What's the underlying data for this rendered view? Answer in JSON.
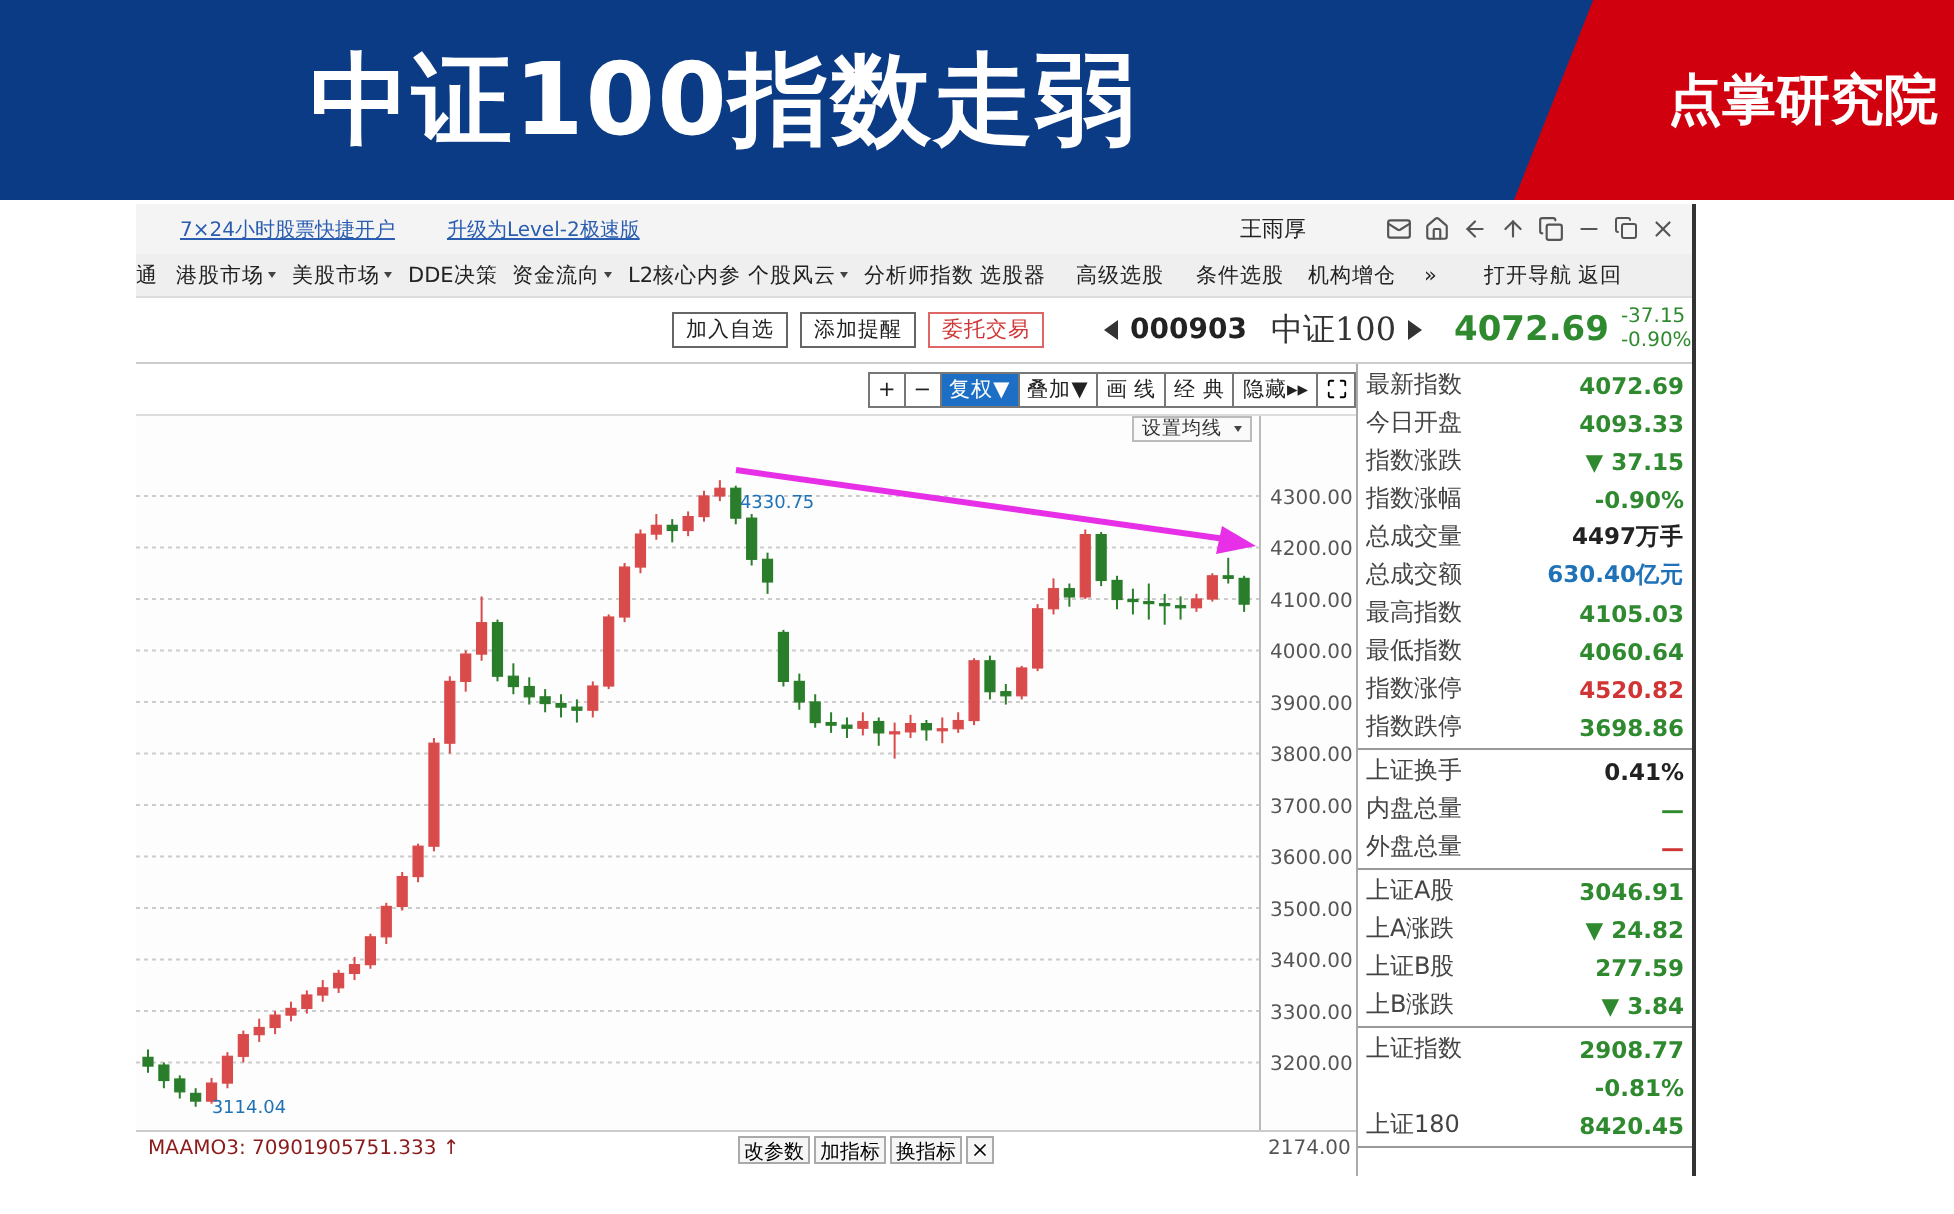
{
  "slide": {
    "title": "中证100指数走弱",
    "brand": "点掌研究院"
  },
  "top_bar": {
    "links": [
      "7×24小时股票快捷开户",
      "升级为Level-2极速版"
    ],
    "user": "王雨厚"
  },
  "menu": [
    {
      "label": "通",
      "dropdown": false
    },
    {
      "label": "港股市场",
      "dropdown": true
    },
    {
      "label": "美股市场",
      "dropdown": true
    },
    {
      "label": "DDE决策",
      "dropdown": false
    },
    {
      "label": "资金流向",
      "dropdown": true
    },
    {
      "label": "L2核心内参",
      "dropdown": false
    },
    {
      "label": "个股风云",
      "dropdown": true
    },
    {
      "label": "分析师指数",
      "dropdown": false
    },
    {
      "label": "选股器",
      "dropdown": false
    },
    {
      "label": "高级选股",
      "dropdown": false
    },
    {
      "label": "条件选股",
      "dropdown": false
    },
    {
      "label": "机构增仓",
      "dropdown": false
    },
    {
      "label": "»",
      "dropdown": false
    },
    {
      "label": "打开导航",
      "dropdown": false
    },
    {
      "label": "返回",
      "dropdown": false
    }
  ],
  "quote": {
    "buttons": [
      {
        "label": "加入自选",
        "kind": "plain"
      },
      {
        "label": "添加提醒",
        "kind": "plain"
      },
      {
        "label": "委托交易",
        "kind": "trade"
      }
    ],
    "code": "000903",
    "name": "中证100",
    "price": "4072.69",
    "change": "-37.15",
    "change_pct": "-0.90%"
  },
  "chart": {
    "toolbar": [
      {
        "label": "+",
        "selected": false
      },
      {
        "label": "−",
        "selected": false
      },
      {
        "label": "复权▼",
        "selected": true
      },
      {
        "label": "叠加▼",
        "selected": false
      },
      {
        "label": "画 线",
        "selected": false
      },
      {
        "label": "经 典",
        "selected": false
      },
      {
        "label": "隐藏▸▸",
        "selected": false
      }
    ],
    "ma_setting": "设置均线",
    "chart_data": {
      "type": "candlestick",
      "grid": true,
      "ylim": [
        3068.9,
        4455.3
      ],
      "yticks": [
        {
          "value": 4300,
          "label": "4300.00"
        },
        {
          "value": 4200,
          "label": "4200.00"
        },
        {
          "value": 4100,
          "label": "4100.00"
        },
        {
          "value": 4000,
          "label": "4000.00"
        },
        {
          "value": 3900,
          "label": "3900.00"
        },
        {
          "value": 3800,
          "label": "3800.00"
        },
        {
          "value": 3700,
          "label": "3700.00"
        },
        {
          "value": 3600,
          "label": "3600.00"
        },
        {
          "value": 3500,
          "label": "3500.00"
        },
        {
          "value": 3400,
          "label": "3400.00"
        },
        {
          "value": 3300,
          "label": "3300.00"
        },
        {
          "value": 3200,
          "label": "3200.00"
        }
      ],
      "categories": [
        null,
        null,
        null,
        null,
        null,
        null,
        null,
        null,
        null,
        null,
        null,
        null,
        null,
        null,
        null,
        null,
        null,
        null,
        null,
        null,
        null,
        null,
        null,
        null,
        null,
        null,
        null,
        null,
        null,
        null,
        null,
        null,
        null,
        null,
        null,
        null,
        null,
        null,
        null,
        null,
        null,
        null,
        null,
        null,
        null,
        null,
        null,
        null,
        null,
        null,
        null,
        null,
        null,
        null,
        null,
        null,
        null,
        null,
        null,
        null,
        null,
        null,
        null,
        null,
        null,
        null,
        null,
        null,
        null,
        null
      ],
      "ohlc": [
        [
          3210,
          3225,
          3180,
          3193
        ],
        [
          3195,
          3200,
          3150,
          3165
        ],
        [
          3168,
          3175,
          3130,
          3143
        ],
        [
          3140,
          3150,
          3114.04,
          3125
        ],
        [
          3125,
          3170,
          3120,
          3160
        ],
        [
          3160,
          3220,
          3150,
          3212
        ],
        [
          3212,
          3262,
          3200,
          3254
        ],
        [
          3254,
          3285,
          3240,
          3268
        ],
        [
          3268,
          3300,
          3255,
          3292
        ],
        [
          3292,
          3318,
          3280,
          3305
        ],
        [
          3305,
          3340,
          3295,
          3331
        ],
        [
          3331,
          3360,
          3318,
          3345
        ],
        [
          3345,
          3380,
          3335,
          3373
        ],
        [
          3373,
          3405,
          3360,
          3390
        ],
        [
          3390,
          3450,
          3382,
          3444
        ],
        [
          3444,
          3510,
          3430,
          3503
        ],
        [
          3503,
          3570,
          3495,
          3561
        ],
        [
          3561,
          3625,
          3550,
          3620
        ],
        [
          3620,
          3830,
          3610,
          3820
        ],
        [
          3820,
          3950,
          3800,
          3940
        ],
        [
          3940,
          4000,
          3920,
          3993
        ],
        [
          3993,
          4105,
          3980,
          4054
        ],
        [
          4054,
          4060,
          3940,
          3950
        ],
        [
          3950,
          3975,
          3915,
          3930
        ],
        [
          3930,
          3948,
          3895,
          3910
        ],
        [
          3910,
          3925,
          3880,
          3897
        ],
        [
          3897,
          3915,
          3870,
          3890
        ],
        [
          3890,
          3905,
          3860,
          3884
        ],
        [
          3884,
          3940,
          3870,
          3931
        ],
        [
          3931,
          4070,
          3925,
          4065
        ],
        [
          4065,
          4170,
          4055,
          4162
        ],
        [
          4162,
          4235,
          4150,
          4226
        ],
        [
          4226,
          4265,
          4215,
          4243
        ],
        [
          4243,
          4255,
          4210,
          4233
        ],
        [
          4233,
          4270,
          4222,
          4260
        ],
        [
          4260,
          4310,
          4250,
          4300
        ],
        [
          4300,
          4330.75,
          4290,
          4315
        ],
        [
          4315,
          4320,
          4245,
          4257
        ],
        [
          4257,
          4265,
          4165,
          4177
        ],
        [
          4177,
          4190,
          4110,
          4133
        ],
        [
          4035,
          4040,
          3930,
          3940
        ],
        [
          3940,
          3955,
          3885,
          3900
        ],
        [
          3900,
          3915,
          3850,
          3860
        ],
        [
          3860,
          3880,
          3840,
          3855
        ],
        [
          3855,
          3870,
          3830,
          3849
        ],
        [
          3849,
          3880,
          3835,
          3862
        ],
        [
          3862,
          3870,
          3815,
          3840
        ],
        [
          3840,
          3860,
          3790,
          3842
        ],
        [
          3842,
          3875,
          3830,
          3858
        ],
        [
          3858,
          3865,
          3825,
          3846
        ],
        [
          3846,
          3870,
          3820,
          3848
        ],
        [
          3848,
          3880,
          3840,
          3864
        ],
        [
          3864,
          3985,
          3855,
          3980
        ],
        [
          3980,
          3990,
          3905,
          3920
        ],
        [
          3920,
          3935,
          3895,
          3912
        ],
        [
          3912,
          3970,
          3905,
          3966
        ],
        [
          3966,
          4090,
          3960,
          4081
        ],
        [
          4081,
          4140,
          4070,
          4120
        ],
        [
          4120,
          4130,
          4085,
          4104
        ],
        [
          4104,
          4235,
          4100,
          4225
        ],
        [
          4225,
          4230,
          4125,
          4136
        ],
        [
          4136,
          4145,
          4080,
          4099
        ],
        [
          4099,
          4120,
          4070,
          4095
        ],
        [
          4095,
          4130,
          4060,
          4091
        ],
        [
          4091,
          4110,
          4050,
          4087
        ],
        [
          4087,
          4105,
          4060,
          4083
        ],
        [
          4083,
          4110,
          4075,
          4100
        ],
        [
          4100,
          4150,
          4095,
          4145
        ],
        [
          4145,
          4180,
          4130,
          4140
        ],
        [
          4140,
          4145,
          4075,
          4090
        ]
      ]
    },
    "high_marker": "4330.75",
    "low_marker": "3114.04",
    "indicator": {
      "label": "MAAMO3: 70901905751.333 ↑",
      "buttons": [
        "改参数",
        "加指标",
        "换指标"
      ],
      "axis_value": "2174.00"
    }
  },
  "panel": {
    "sections": [
      {
        "rows": [
          {
            "label": "最新指数",
            "value": "4072.69",
            "color": "#2f8a2f"
          },
          {
            "label": "今日开盘",
            "value": "4093.33",
            "color": "#2f8a2f"
          },
          {
            "label": "指数涨跌",
            "value": "▼ 37.15",
            "color": "#2f8a2f"
          },
          {
            "label": "指数涨幅",
            "value": "-0.90%",
            "color": "#2f8a2f"
          },
          {
            "label": "总成交量",
            "value": "4497万手",
            "color": "#222222"
          },
          {
            "label": "总成交额",
            "value": "630.40亿元",
            "color": "#1f72b8"
          },
          {
            "label": "最高指数",
            "value": "4105.03",
            "color": "#2f8a2f"
          },
          {
            "label": "最低指数",
            "value": "4060.64",
            "color": "#2f8a2f"
          },
          {
            "label": "指数涨停",
            "value": "4520.82",
            "color": "#d03434"
          },
          {
            "label": "指数跌停",
            "value": "3698.86",
            "color": "#2f8a2f"
          }
        ]
      },
      {
        "rows": [
          {
            "label": "上证换手",
            "value": "0.41%",
            "color": "#222222"
          },
          {
            "label": "内盘总量",
            "value": "—",
            "color": "#2f8a2f"
          },
          {
            "label": "外盘总量",
            "value": "—",
            "color": "#d03434"
          }
        ]
      },
      {
        "rows": [
          {
            "label": "上证A股",
            "value": "3046.91",
            "color": "#2f8a2f"
          },
          {
            "label": "上A涨跌",
            "value": "▼ 24.82",
            "color": "#2f8a2f"
          },
          {
            "label": "上证B股",
            "value": "277.59",
            "color": "#2f8a2f"
          },
          {
            "label": "上B涨跌",
            "value": "▼ 3.84",
            "color": "#2f8a2f"
          }
        ]
      },
      {
        "rows": [
          {
            "label": "上证指数",
            "value": "2908.77",
            "value_2": "-0.81%",
            "color": "#2f8a2f"
          },
          {
            "label": "上证180",
            "value": "8420.45",
            "color": "#2f8a2f"
          }
        ]
      }
    ]
  }
}
